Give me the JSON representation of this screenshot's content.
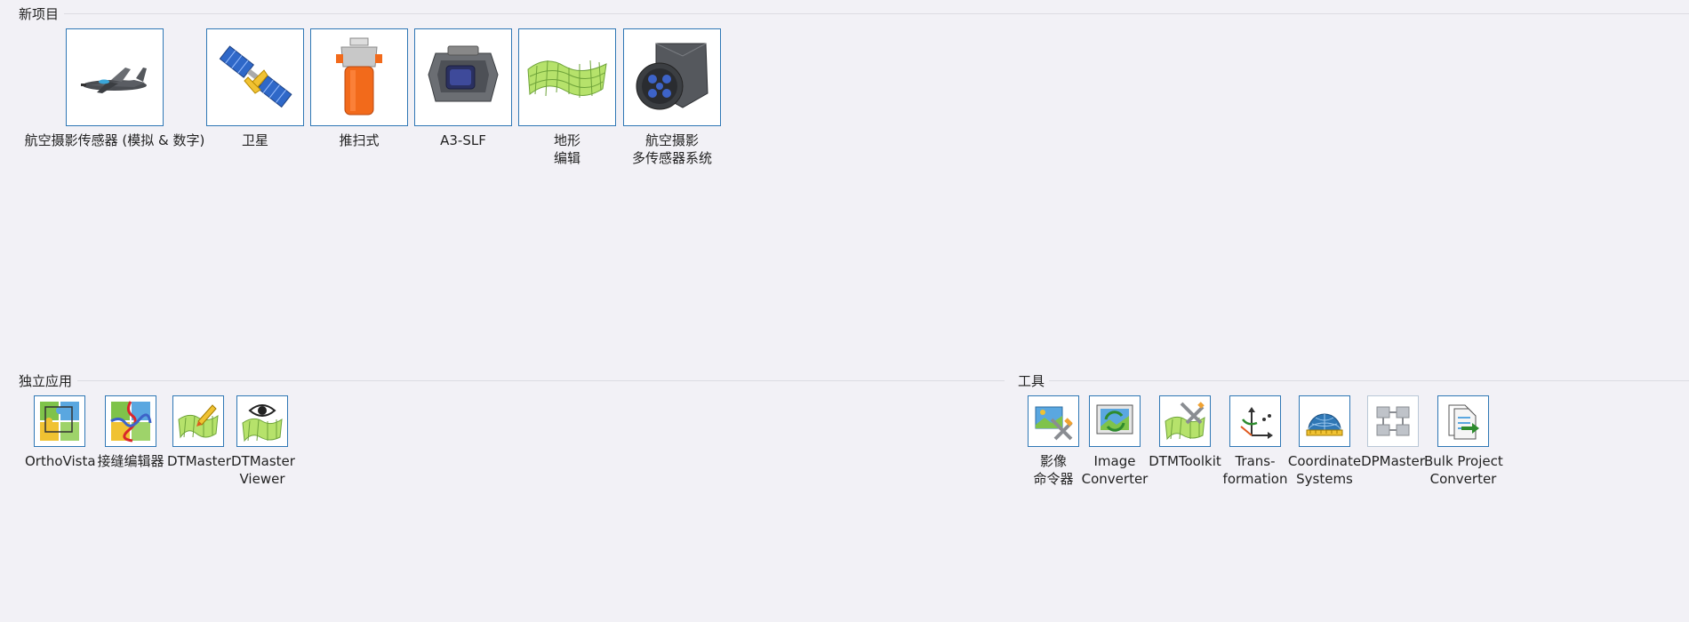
{
  "sections": {
    "new_project": "新项目",
    "standalone": "独立应用",
    "tools": "工具"
  },
  "new_project_items": [
    {
      "line1": "航空摄影传感器 (模拟 & 数字)",
      "line2": ""
    },
    {
      "line1": "卫星",
      "line2": ""
    },
    {
      "line1": "推扫式",
      "line2": ""
    },
    {
      "line1": "A3-SLF",
      "line2": ""
    },
    {
      "line1": "地形",
      "line2": "编辑"
    },
    {
      "line1": "航空摄影",
      "line2": "多传感器系统"
    }
  ],
  "standalone_items": [
    {
      "line1": "OrthoVista",
      "line2": ""
    },
    {
      "line1": "接缝编辑器",
      "line2": ""
    },
    {
      "line1": "DTMaster",
      "line2": ""
    },
    {
      "line1": "DTMaster",
      "line2": "Viewer"
    }
  ],
  "tools_items": [
    {
      "line1": "影像",
      "line2": "命令器"
    },
    {
      "line1": "Image",
      "line2": "Converter"
    },
    {
      "line1": "DTMToolkit",
      "line2": ""
    },
    {
      "line1": "Trans-",
      "line2": "formation"
    },
    {
      "line1": "Coordinate",
      "line2": "Systems"
    },
    {
      "line1": "DPMaster",
      "line2": ""
    },
    {
      "line1": "Bulk Project",
      "line2": "Converter"
    }
  ],
  "icons": {
    "accent": "#2f77b5",
    "terrain_green": "#b6e26b",
    "orange": "#f26a1b"
  }
}
